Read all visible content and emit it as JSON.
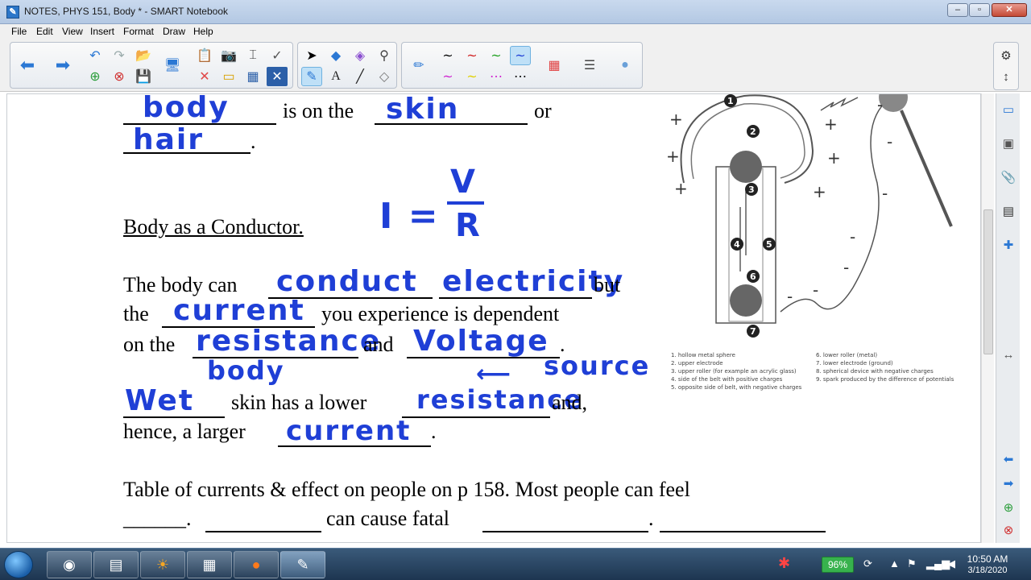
{
  "window": {
    "title": "NOTES, PHYS 151, Body * - SMART Notebook",
    "min": "–",
    "max": "▫",
    "close": "✕"
  },
  "menu": [
    "File",
    "Edit",
    "View",
    "Insert",
    "Format",
    "Draw",
    "Help"
  ],
  "colors": {
    "ink_blue": "#1f3fd6",
    "titlebar": "#b3c8e3",
    "battery": "#37b24d"
  },
  "document": {
    "line1_mid": "is on the",
    "line1_end": "or",
    "line2_end": ".",
    "heading": "Body as a Conductor.",
    "p1_a": "The body can",
    "p1_b": "but",
    "p2_a": "the",
    "p2_b": "you experience is dependent",
    "p3_a": "on the",
    "p3_b": "and",
    "p3_c": ".",
    "p4_a": "skin has a lower",
    "p4_b": "and,",
    "p5_a": "hence, a larger",
    "p5_b": ".",
    "p6": "Table of currents & effect on people on p 158. Most people can feel",
    "p7_a": "______.",
    "p7_b": "can cause fatal",
    "p7_c": "."
  },
  "ink": {
    "body1": "body",
    "skin": "skin",
    "hair": "hair",
    "formula_i": "I =",
    "formula_v": "V",
    "formula_r": "R",
    "conduct": "conduct",
    "electricity": "electricity",
    "current1": "current",
    "resistance1": "resistance",
    "voltage": "Voltage",
    "body2": "body",
    "source": "source",
    "wet": "Wet",
    "resistance2": "resistance",
    "current2": "current"
  },
  "diagram": {
    "labels": [
      "1",
      "2",
      "3",
      "4",
      "5",
      "6",
      "7"
    ],
    "legend_left": [
      "1. hollow metal sphere",
      "2. upper electrode",
      "3. upper roller (for example an acrylic glass)",
      "4. side of the belt with positive charges",
      "5. opposite side of belt, with negative charges"
    ],
    "legend_right": [
      "6. lower roller (metal)",
      "7. lower electrode (ground)",
      "8. spherical device with negative charges",
      "9. spark produced by the difference of potentials"
    ]
  },
  "taskbar": {
    "battery": "96%",
    "time": "10:50 AM",
    "date": "3/18/2020"
  }
}
